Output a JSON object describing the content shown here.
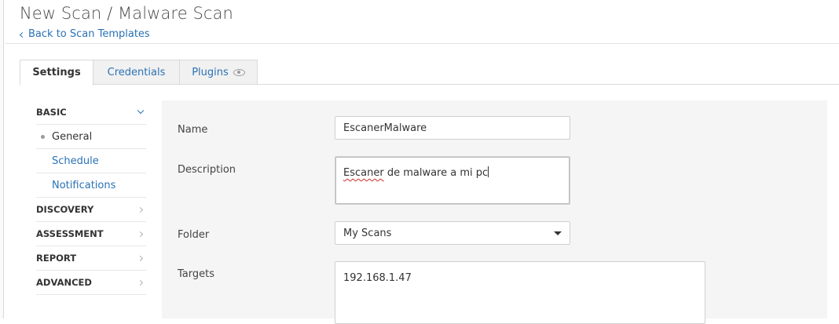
{
  "header": {
    "title": "New Scan / Malware Scan",
    "back_link": "Back to Scan Templates"
  },
  "tabs": [
    {
      "label": "Settings",
      "active": true
    },
    {
      "label": "Credentials",
      "active": false
    },
    {
      "label": "Plugins",
      "active": false,
      "icon": "eye-icon"
    }
  ],
  "sidebar": {
    "sections": [
      {
        "label": "BASIC",
        "expanded": true,
        "items": [
          {
            "label": "General",
            "current": true
          },
          {
            "label": "Schedule",
            "current": false
          },
          {
            "label": "Notifications",
            "current": false
          }
        ]
      },
      {
        "label": "DISCOVERY",
        "expanded": false
      },
      {
        "label": "ASSESSMENT",
        "expanded": false
      },
      {
        "label": "REPORT",
        "expanded": false
      },
      {
        "label": "ADVANCED",
        "expanded": false
      }
    ]
  },
  "form": {
    "name_label": "Name",
    "name_value": "EscanerMalware",
    "description_label": "Description",
    "description_value_misspelled": "Escaner",
    "description_value_rest": " de malware a mi pc",
    "folder_label": "Folder",
    "folder_value": "My Scans",
    "targets_label": "Targets",
    "targets_value": "192.168.1.47"
  },
  "colors": {
    "link": "#2a72b5",
    "panel_bg": "#f5f5f5",
    "tab_inactive_bg": "#f1f1f1"
  }
}
